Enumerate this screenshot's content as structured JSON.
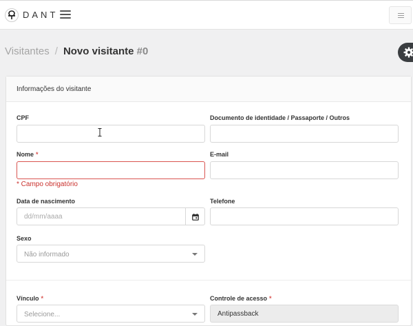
{
  "header": {
    "logo_text": "DANT"
  },
  "breadcrumb": {
    "parent": "Visitantes",
    "separator": "/",
    "current": "Novo visitante",
    "id": "#0"
  },
  "card": {
    "title": "Informações do visitante"
  },
  "form": {
    "cpf": {
      "label": "CPF",
      "value": ""
    },
    "document": {
      "label": "Documento de identidade / Passaporte / Outros",
      "value": ""
    },
    "name": {
      "label": "Nome",
      "required_mark": "*",
      "value": "",
      "error": "* Campo obrigatório"
    },
    "email": {
      "label": "E-mail",
      "value": ""
    },
    "birthdate": {
      "label": "Data de nascimento",
      "placeholder": "dd/mm/aaaa"
    },
    "phone": {
      "label": "Telefone",
      "value": ""
    },
    "sex": {
      "label": "Sexo",
      "selected": "Não informado"
    },
    "link": {
      "label": "Vínculo",
      "required_mark": "*",
      "selected": "Selecione..."
    },
    "access_control": {
      "label": "Controle de acesso",
      "required_mark": "*",
      "value": "Antipassback"
    }
  },
  "icons": {
    "logo": "logo-mark-icon",
    "menu": "hamburger-icon",
    "settings": "gear-icon",
    "calendar": "calendar-icon",
    "cursor": "text-cursor-icon"
  },
  "colors": {
    "error": "#d9534f",
    "dark_button": "#3a3d40"
  }
}
